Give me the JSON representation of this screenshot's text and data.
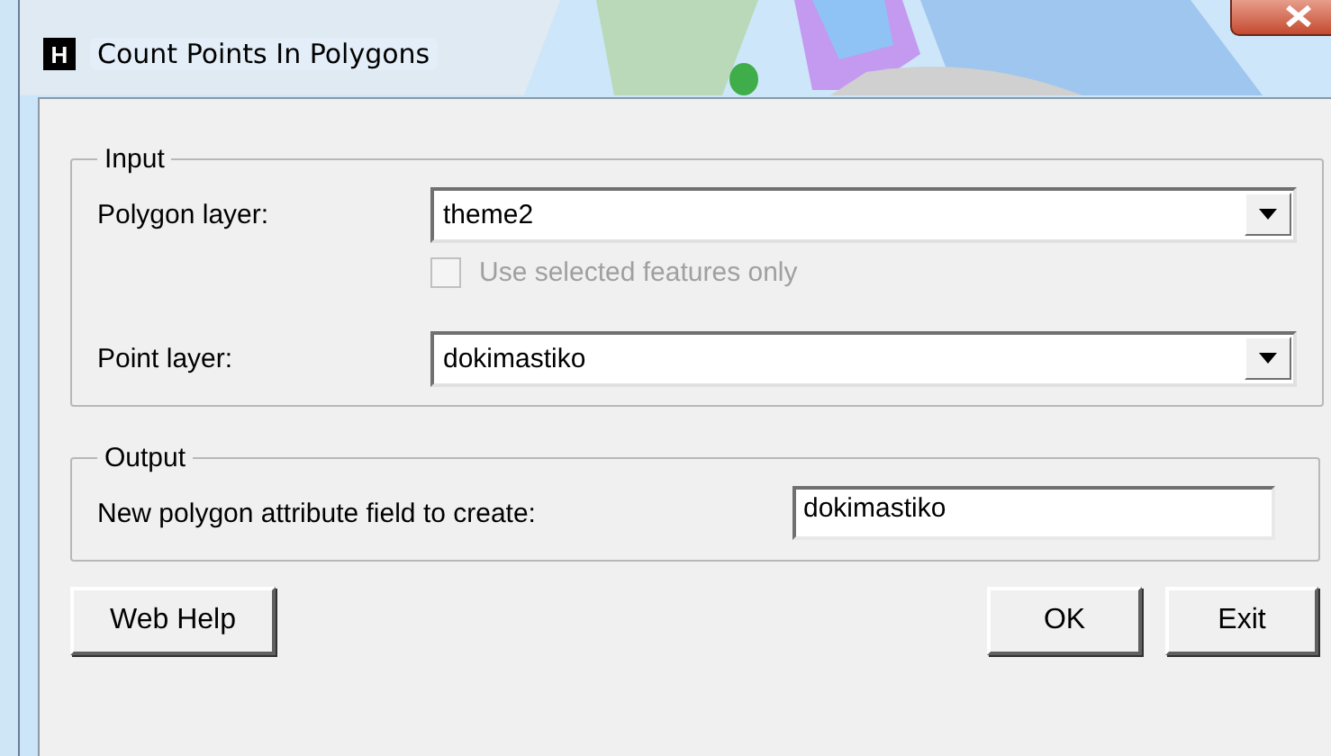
{
  "window": {
    "title": "Count Points In Polygons",
    "app_letter": "H"
  },
  "input_group": {
    "title": "Input",
    "polygon_layer": {
      "label": "Polygon layer:",
      "value": "theme2"
    },
    "use_selected": {
      "label": "Use selected features only",
      "checked": false,
      "disabled": true
    },
    "point_layer": {
      "label": "Point layer:",
      "value": "dokimastiko"
    }
  },
  "output_group": {
    "title": "Output",
    "field": {
      "label": "New polygon attribute field to create:",
      "value": "dokimastiko"
    }
  },
  "buttons": [
    {
      "label": "Web Help",
      "kind": "help"
    },
    {
      "label": "OK",
      "kind": "ok"
    },
    {
      "label": "Exit",
      "kind": "exit"
    }
  ]
}
